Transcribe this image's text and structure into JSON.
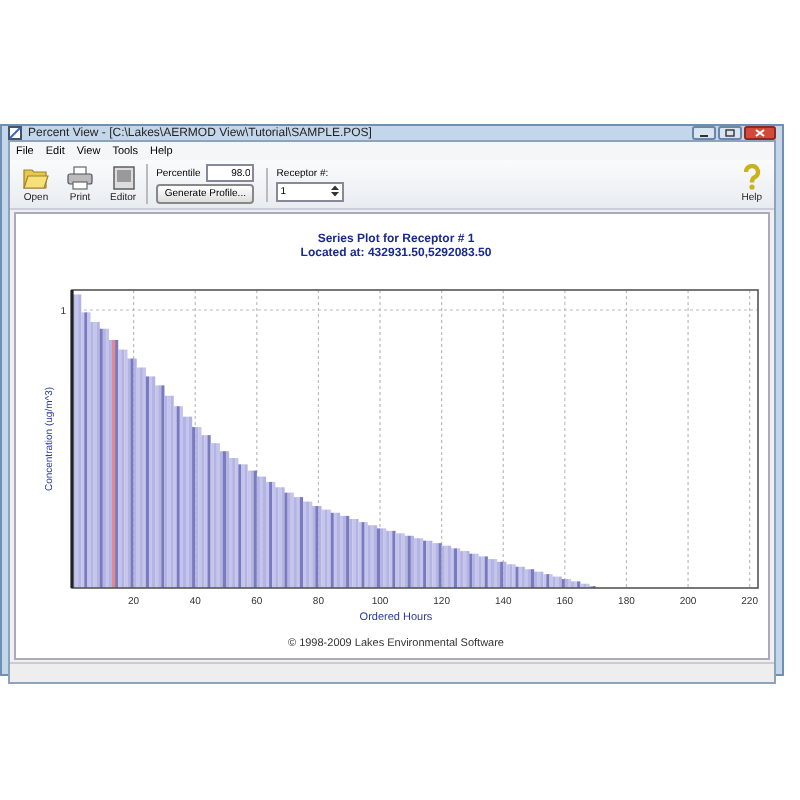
{
  "window": {
    "title": "Percent View - [C:\\Lakes\\AERMOD View\\Tutorial\\SAMPLE.POS]"
  },
  "menu": [
    "File",
    "Edit",
    "View",
    "Tools",
    "Help"
  ],
  "toolbar": {
    "buttons": [
      {
        "label": "Open",
        "kind": "open"
      },
      {
        "label": "Print",
        "kind": "print"
      },
      {
        "label": "Editor",
        "kind": "editor"
      }
    ],
    "percentile": {
      "label": "Percentile",
      "value": "98.0"
    },
    "generate_button": "Generate Profile...",
    "receptor": {
      "label": "Receptor #:",
      "value": "1"
    },
    "help": {
      "label": "Help"
    }
  },
  "chart": {
    "title": "Series Plot for Receptor # 1",
    "subtitle": "Located at: 432931.50,5292083.50",
    "ylabel": "Concentration (ug/m^3)",
    "yticks": [
      "1"
    ],
    "xlabel": "Ordered Hours",
    "xticks": [
      "20",
      "40",
      "60",
      "80",
      "100",
      "120",
      "140",
      "160",
      "180",
      "200",
      "220"
    ],
    "footer": "© 1998-2009 Lakes Environmental Software"
  }
}
